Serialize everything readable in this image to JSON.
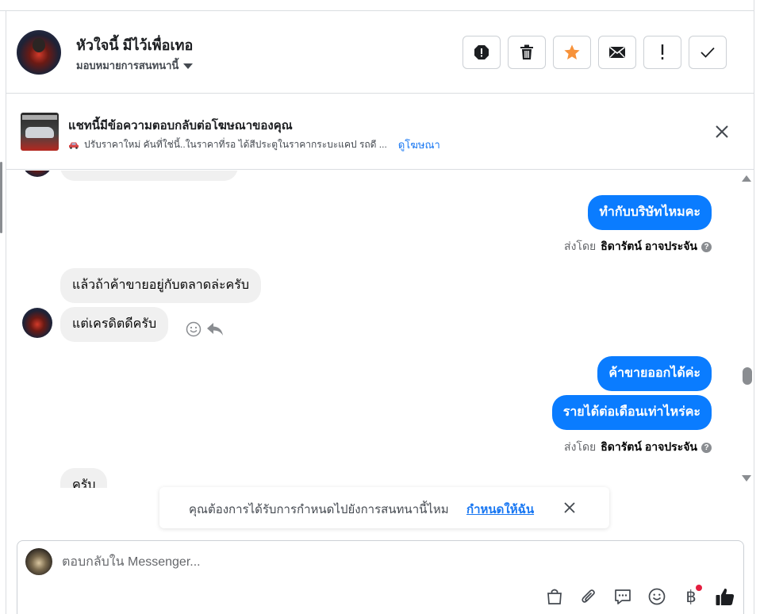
{
  "header": {
    "contact_name": "หัวใจนี้ มีไว้เพื่อเทอ",
    "assign_label": "มอบหมายการสนทนานี้",
    "toolbar": [
      {
        "name": "spam-button",
        "icon": "exclamation-octagon-icon"
      },
      {
        "name": "delete-button",
        "icon": "trash-icon"
      },
      {
        "name": "star-button",
        "icon": "star-icon",
        "color": "#f7923a"
      },
      {
        "name": "mark-unread-button",
        "icon": "envelope-icon"
      },
      {
        "name": "follow-up-button",
        "icon": "exclamation-icon"
      },
      {
        "name": "mark-done-button",
        "icon": "checkmark-icon"
      }
    ]
  },
  "ad": {
    "title": "แชทนี้มีข้อความตอบกลับต่อโฆษณาของคุณ",
    "description": "ปรับราคาใหม่ คันที่ใช่นี้..ในราคาที่รอ ได้สีประตูในราคากระบะแคป รถดี ...",
    "link": "ดูโฆษณา"
  },
  "messages": {
    "out1": "ทำกับบริษัทไหมคะ",
    "sent_by_label": "ส่งโดย",
    "sent_by_name": "ธิดารัตน์ อาจประจัน",
    "in1": "แล้วถ้าค้าขายอยู่กับตลาดล่ะครับ",
    "in2": "แต่เครดิตดีครับ",
    "out2": "ค้าขายออกได้ค่ะ",
    "out3": "รายได้ต่อเดือนเท่าไหร่คะ",
    "in3_partial": "ครับ"
  },
  "toast": {
    "text": "คุณต้องการได้รับการกำหนดไปยังการสนทนานี้ไหม",
    "link": "กำหนดให้ฉัน"
  },
  "composer": {
    "placeholder": "ตอบกลับใน Messenger...",
    "baht_symbol": "฿"
  },
  "colors": {
    "accent": "#1877f2",
    "outgoing_bubble": "#0a7cff",
    "incoming_bubble": "#f0f0f0",
    "star": "#f7923a",
    "notification_dot": "#e41e3f"
  }
}
